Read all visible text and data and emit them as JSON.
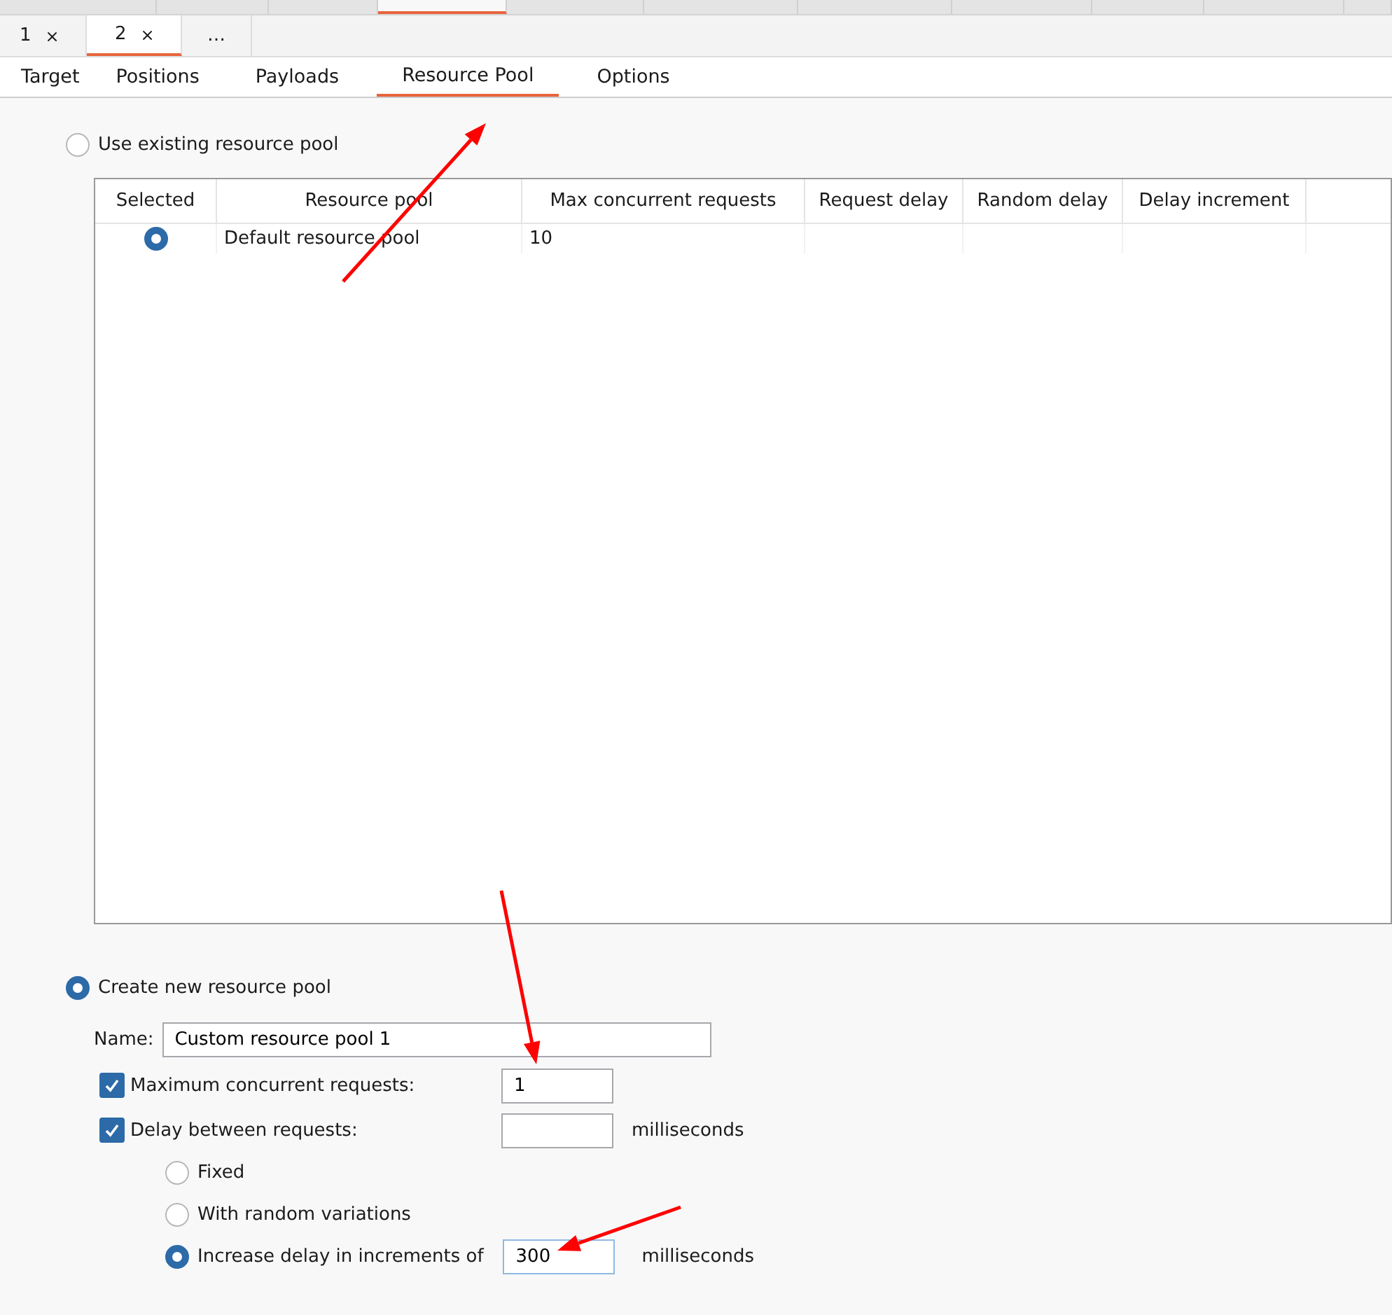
{
  "main_tabs": [
    {
      "selected": false
    },
    {
      "selected": false
    },
    {
      "selected": false
    },
    {
      "selected": true
    },
    {
      "selected": false
    },
    {
      "selected": false
    },
    {
      "selected": false
    },
    {
      "selected": false
    },
    {
      "selected": false
    },
    {
      "selected": false
    },
    {
      "selected": false
    }
  ],
  "attack_tabs": [
    {
      "label": "1",
      "close": "×",
      "selected": false
    },
    {
      "label": "2",
      "close": "×",
      "selected": true
    },
    {
      "label": "…",
      "selected": false
    }
  ],
  "sub_tabs": [
    {
      "label": "Target",
      "selected": false
    },
    {
      "label": "Positions",
      "selected": false
    },
    {
      "label": "Payloads",
      "selected": false
    },
    {
      "label": "Resource Pool",
      "selected": true
    },
    {
      "label": "Options",
      "selected": false
    }
  ],
  "existing_pool": {
    "label": "Use existing resource pool",
    "selected": false,
    "table": {
      "columns": [
        "Selected",
        "Resource pool",
        "Max concurrent requests",
        "Request delay",
        "Random delay",
        "Delay increment"
      ],
      "rows": [
        {
          "selected": true,
          "cells": [
            "",
            "Default resource pool",
            "10"
          ]
        }
      ]
    }
  },
  "new_pool": {
    "label": "Create new resource pool",
    "selected": true,
    "name_label": "Name:",
    "name_value": "Custom resource pool 1",
    "options": [
      {
        "label": "Maximum concurrent requests:",
        "checked": true,
        "value": "1"
      },
      {
        "label": "Delay between requests:",
        "checked": true,
        "unit": "milliseconds"
      }
    ],
    "delay_modes": [
      {
        "label": "Fixed",
        "selected": false
      },
      {
        "label": "With random variations",
        "selected": false
      },
      {
        "label": "Increase delay in increments of",
        "selected": true,
        "value": "300",
        "unit": "milliseconds"
      }
    ]
  },
  "annotations": [
    {
      "kind": "arrow"
    },
    {
      "kind": "arrow"
    },
    {
      "kind": "arrow"
    }
  ]
}
